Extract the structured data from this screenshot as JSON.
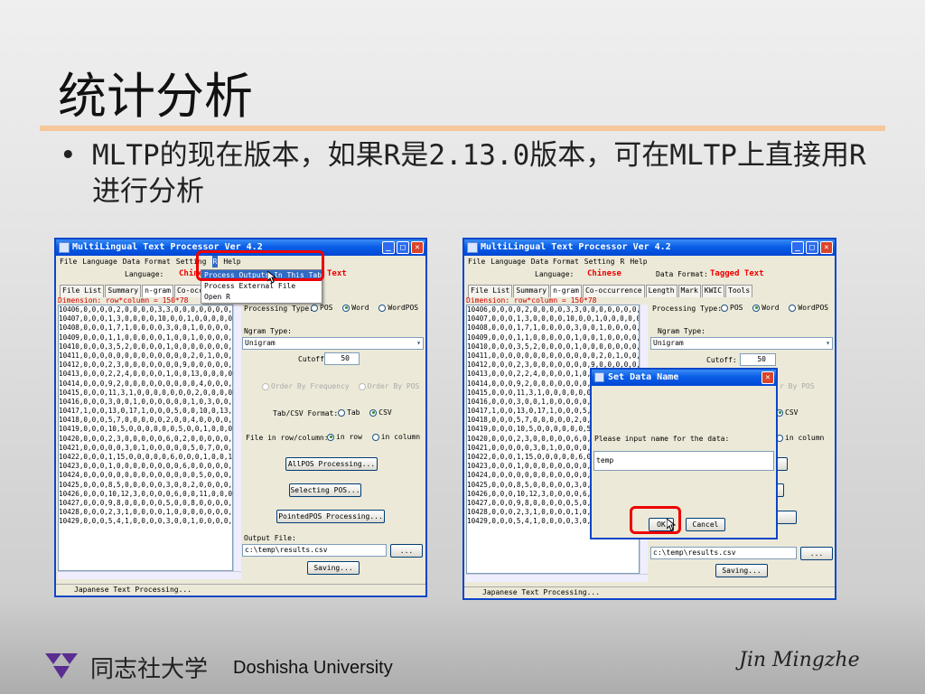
{
  "slide": {
    "title": "统计分析",
    "bullet_marker": "•",
    "bullet_text": "MLTP的现在版本，如果R是2.13.0版本，可在MLTP上直接用R进行分析",
    "colors": {
      "title_rule": "#f5c79a",
      "highlight_box": "#ee0000",
      "titlebar": "#0a5ee6"
    }
  },
  "left_window": {
    "title": "MultiLingual Text Processor Ver 4.2",
    "menu": [
      "File",
      "Language",
      "Data Format",
      "Setting",
      "R",
      "Help"
    ],
    "language_label": "Language:",
    "language_value": "Chinese",
    "format_value_partial": "Text",
    "tabs": [
      "File List",
      "Summary",
      "n-gram",
      "Co-occurrence"
    ],
    "dimension": "Dimension: row*column = 150*78",
    "rows": [
      "10406,0,0,0,0,2,0,0,0,0,3,3,0,0,0,0,0,0,0,0,2,2",
      "10407,0,0,0,1,3,0,0,0,0,10,0,0,1,0,0,0,0,0,0,2,",
      "10408,0,0,0,1,7,1,0,0,0,0,3,0,0,1,0,0,0,0,4,0,0,4,3",
      "10409,0,0,0,1,1,0,0,0,0,0,1,0,0,1,0,0,0,0,0,0,3,4",
      "10410,0,0,0,3,5,2,0,0,0,0,1,0,0,0,0,0,0,0,0,4,3",
      "10411,0,0,0,0,0,0,0,0,0,0,0,0,0,2,0,1,0,0,0,0,0,0",
      "10412,0,0,0,2,3,0,0,0,0,0,0,0,9,0,0,0,0,0,0,0,1",
      "10413,0,0,0,2,2,4,0,0,0,0,1,0,0,13,0,0,0,0,0,0,",
      "10414,0,0,0,9,2,0,0,0,0,0,0,0,0,0,4,0,0,0,0,0,0",
      "10415,0,0,0,11,3,1,0,0,0,0,0,0,0,2,0,0,0,0,0,0,1,",
      "10416,0,0,0,3,0,0,1,0,0,0,0,0,0,1,0,3,0,0,0,0,1,0",
      "10417,1,0,0,13,0,17,1,0,0,0,5,0,0,10,0,13,0,1,0,0,",
      "10418,0,0,0,5,7,0,0,0,0,0,2,0,0,4,0,0,0,0,0,0,7,2",
      "10419,0,0,0,10,5,0,0,0,0,0,0,5,0,0,1,0,0,0,0,0,0,",
      "10420,0,0,0,2,3,0,0,0,0,0,6,0,2,0,0,0,0,0,0,0,5,4",
      "10421,0,0,0,0,0,3,0,1,0,0,0,0,0,5,0,7,0,0,0,0,6,0",
      "10422,0,0,0,1,15,0,0,0,0,0,6,0,0,0,1,0,0,1,0,0,0,1,",
      "10423,0,0,0,1,0,0,0,0,0,0,0,0,6,0,0,0,0,0,0,0,6,3",
      "10424,0,0,0,0,0,0,0,0,0,0,0,0,0,0,5,0,0,0,0,0,0,0",
      "10425,0,0,0,8,5,0,0,0,0,0,3,0,0,2,0,0,0,0,0,0,5,2",
      "10426,0,0,0,10,12,3,0,0,0,0,6,0,0,11,0,0,0,0,0,0,0",
      "10427,0,0,0,9,8,0,0,0,0,0,5,0,0,8,0,0,0,0,0,0,4,0",
      "10428,0,0,0,2,3,1,0,0,0,0,1,0,0,0,0,0,0,0,0,3,2",
      "10429,0,0,0,5,4,1,0,0,0,0,3,0,0,1,0,0,0,0,0,3,1"
    ],
    "r_menu_items": [
      "Process Outputs In This Tab",
      "Process External File",
      "Open R"
    ],
    "processing_type_label": "Processing Type:",
    "processing_options": [
      "POS",
      "Word",
      "WordPOS"
    ],
    "processing_selected": "Word",
    "ngram_type_label": "Ngram Type:",
    "ngram_type_value": "Unigram",
    "cutoff_label": "Cutoff:",
    "cutoff_value": "50",
    "order_options": [
      "Order By Frequency",
      "Order By POS"
    ],
    "tabcsv_label": "Tab/CSV Format:",
    "tabcsv_options": [
      "Tab",
      "CSV"
    ],
    "tabcsv_selected": "CSV",
    "file_in_label": "File in row/column:",
    "file_in_options": [
      "in row",
      "in column"
    ],
    "file_in_selected": "in row",
    "allpos_button": "AllPOS Processing...",
    "selecting_button": "Selecting POS...",
    "pointed_button": "PointedPOS Processing...",
    "output_label": "Output File:",
    "output_value": "c:\\temp\\results.csv",
    "browse_button": "...",
    "saving_button": "Saving...",
    "status": "Japanese Text Processing..."
  },
  "right_window": {
    "title": "MultiLingual Text Processor Ver 4.2",
    "menu": [
      "File",
      "Language",
      "Data Format",
      "Setting",
      "R",
      "Help"
    ],
    "language_label": "Language:",
    "language_value": "Chinese",
    "format_label": "Data Format:",
    "format_value": "Tagged Text",
    "tabs": [
      "File List",
      "Summary",
      "n-gram",
      "Co-occurrence",
      "Length",
      "Mark",
      "KWIC",
      "Tools"
    ],
    "dimension": "Dimension: row*column = 150*78",
    "processing_type_label": "Processing Type:",
    "processing_options": [
      "POS",
      "Word",
      "WordPOS"
    ],
    "ngram_type_label": "Ngram Type:",
    "ngram_type_value": "Unigram",
    "cutoff_label": "Cutoff:",
    "cutoff_value": "50",
    "order_partial": "r By POS",
    "csv_partial": "CSV",
    "in_column_partial": "in column",
    "output_partial": "c:\\temp\\results.csv",
    "browse_button": "...",
    "saving_button": "Saving...",
    "status": "Japanese Text Processing...",
    "dialog": {
      "title": "Set Data Name",
      "prompt": "Please input name for the data:",
      "input_value": "temp",
      "ok": "OK",
      "cancel": "Cancel"
    }
  },
  "footer": {
    "university_cn": "同志社大学",
    "university_en": "Doshisha University",
    "author": "Jin Mingzhe"
  }
}
